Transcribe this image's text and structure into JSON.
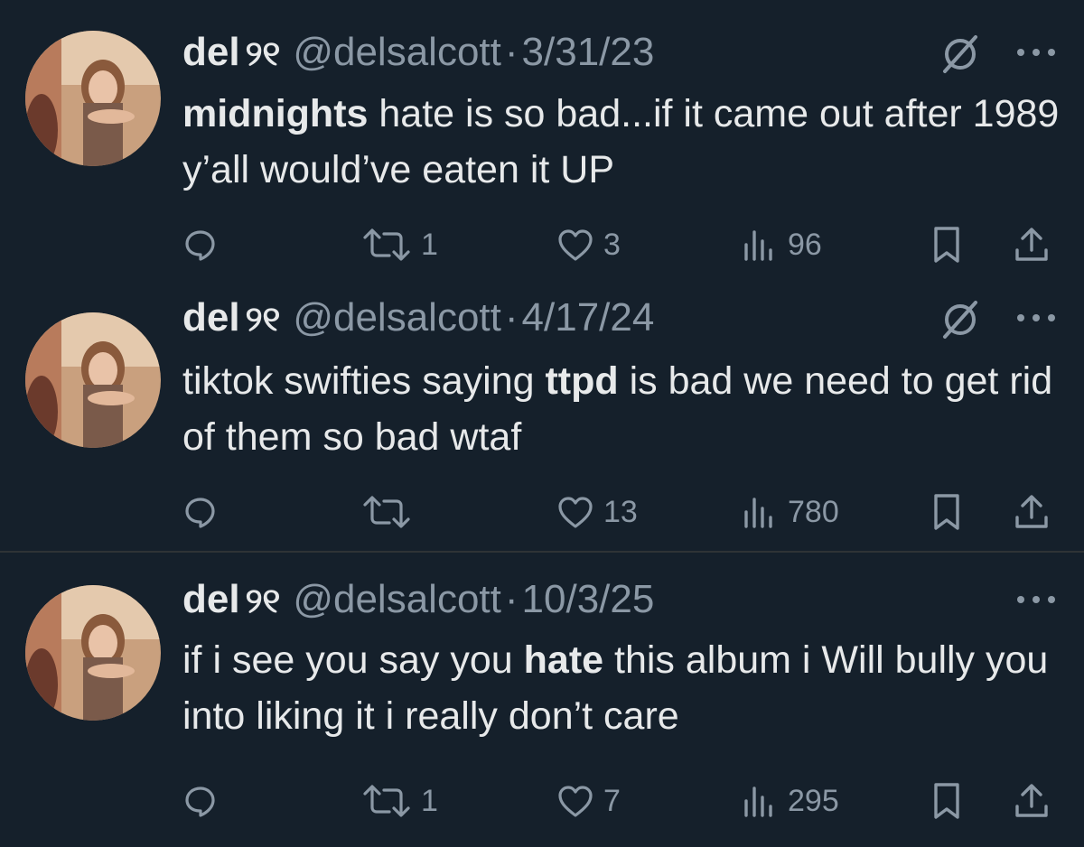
{
  "colors": {
    "background": "#15202b",
    "text": "#e7e9ea",
    "muted": "#8b98a5",
    "divider": "#2f3336"
  },
  "tweets": [
    {
      "name": "del",
      "name_deco": "୨୧",
      "handle": "@delsalcott",
      "separator": "·",
      "date": "3/31/23",
      "show_grok": true,
      "body_parts": [
        {
          "text": "midnights",
          "bold": true
        },
        {
          "text": " hate is so bad...if it came out after 1989 y’all would’ve eaten it UP",
          "bold": false
        }
      ],
      "replies": "",
      "reposts": "1",
      "likes": "3",
      "views": "96"
    },
    {
      "name": "del",
      "name_deco": "୨୧",
      "handle": "@delsalcott",
      "separator": "·",
      "date": "4/17/24",
      "show_grok": true,
      "body_parts": [
        {
          "text": "tiktok swifties saying ",
          "bold": false
        },
        {
          "text": "ttpd",
          "bold": true
        },
        {
          "text": " is bad we need to get rid of them so bad wtaf",
          "bold": false
        }
      ],
      "replies": "",
      "reposts": "",
      "likes": "13",
      "views": "780"
    },
    {
      "name": "del",
      "name_deco": "୨୧",
      "handle": "@delsalcott",
      "separator": "·",
      "date": "10/3/25",
      "show_grok": false,
      "body_parts": [
        {
          "text": "if i see you say you ",
          "bold": false
        },
        {
          "text": "hate",
          "bold": true
        },
        {
          "text": " this album i Will bully you into liking it i really don’t care",
          "bold": false
        }
      ],
      "replies": "",
      "reposts": "1",
      "likes": "7",
      "views": "295"
    }
  ],
  "icons": {
    "reply": "reply-icon",
    "repost": "repost-icon",
    "like": "heart-icon",
    "views": "views-chart-icon",
    "bookmark": "bookmark-icon",
    "share": "share-icon",
    "grok": "grok-icon",
    "more": "more-icon"
  }
}
